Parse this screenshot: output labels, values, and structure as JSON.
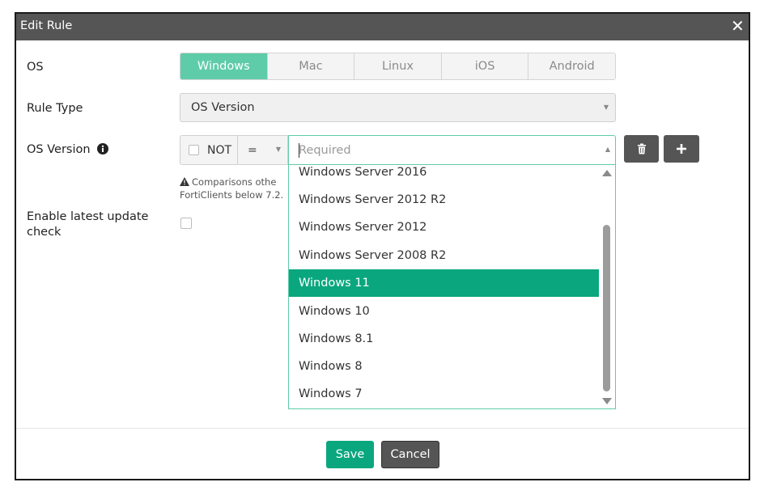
{
  "dialog": {
    "title": "Edit Rule",
    "close_icon": "close-icon"
  },
  "os": {
    "label": "OS",
    "options": [
      "Windows",
      "Mac",
      "Linux",
      "iOS",
      "Android"
    ],
    "selected": "Windows"
  },
  "rule_type": {
    "label": "Rule Type",
    "value": "OS Version"
  },
  "os_version": {
    "label": "OS Version",
    "info_icon": "info-icon",
    "not_label": "NOT",
    "not_checked": false,
    "operator": "=",
    "placeholder": "Required",
    "note_line1": "Comparisons othe",
    "note_line2": "FortiClients below 7.2.",
    "options": [
      "Windows Server 2016",
      "Windows Server 2012 R2",
      "Windows Server 2012",
      "Windows Server 2008 R2",
      "Windows 11",
      "Windows 10",
      "Windows 8.1",
      "Windows 8",
      "Windows 7"
    ],
    "highlighted": "Windows 11"
  },
  "latest_update": {
    "label_line1": "Enable latest update",
    "label_line2": "check",
    "checked": false
  },
  "buttons": {
    "save": "Save",
    "cancel": "Cancel",
    "delete_icon": "trash-icon",
    "add_icon": "plus-icon"
  },
  "colors": {
    "accent": "#5fcca9",
    "primary": "#0aa77f",
    "titlebar": "#555555"
  }
}
